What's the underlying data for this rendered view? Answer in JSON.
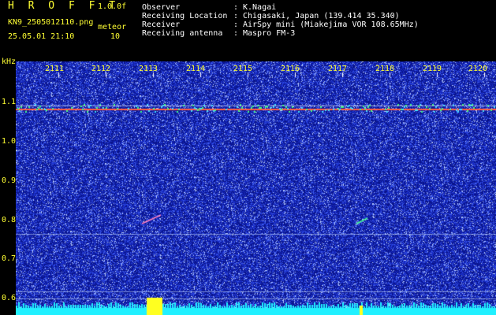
{
  "header": {
    "app_title": "H R O F F T",
    "version": "1.0.0f",
    "filename": "KN9_2505012110.png",
    "datetime": "25.05.01 21:10",
    "mode_label": "meteor",
    "mode_value": "10"
  },
  "info": [
    {
      "label": "Observer",
      "sep": ":",
      "value": "K.Nagai"
    },
    {
      "label": "Receiving Location",
      "sep": ":",
      "value": "Chigasaki, Japan (139.414 35.340)"
    },
    {
      "label": "Receiver",
      "sep": ":",
      "value": "AirSpy mini (Miakejima VOR 108.65MHz)"
    },
    {
      "label": "Receiving antenna",
      "sep": ":",
      "value": "Maspro FM-3"
    }
  ],
  "axis": {
    "y_unit": "kHz",
    "y_ticks": [
      "1.1",
      "1.0",
      "0.9",
      "0.8",
      "0.7",
      "0.6"
    ],
    "x_ticks": [
      "2111",
      "2112",
      "2113",
      "2114",
      "2115",
      "2116",
      "2117",
      "2118",
      "2119",
      "2120"
    ]
  },
  "colors": {
    "label": "#ffff33",
    "value": "#ffffff",
    "background": "#000000",
    "noise_blue": "#1a2ad0",
    "carrier": "#ff6040"
  }
}
